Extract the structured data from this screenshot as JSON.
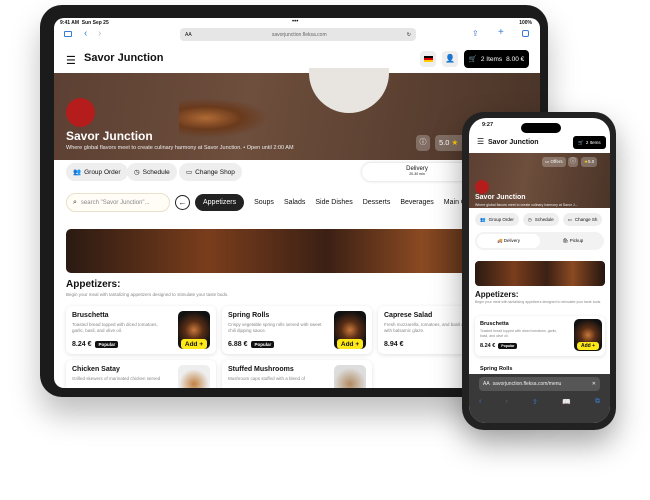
{
  "tablet": {
    "status": {
      "time": "9:41 AM",
      "date": "Sun Sep 25",
      "battery": "100%"
    },
    "browser": {
      "aa": "AA",
      "url": "savorjunction.fleksa.com"
    },
    "header": {
      "title": "Savor Junction",
      "cart_items": "2 Items",
      "cart_total": "8.00 €"
    },
    "hero": {
      "title": "Savor Junction",
      "subtitle": "Where global flavors meet to create culinary harmony at Savor Junction.",
      "open": "Open until 2:00 AM",
      "rating": "5.0"
    },
    "actions": [
      "Group Order",
      "Schedule",
      "Change Shop"
    ],
    "delivery": {
      "label": "Delivery",
      "time": "20-30 min"
    },
    "search_placeholder": "search \"Savor Junction\"...",
    "categories": [
      "Appetizers",
      "Soups",
      "Salads",
      "Side Dishes",
      "Desserts",
      "Beverages",
      "Main Cou"
    ],
    "section": {
      "title": "Appetizers:",
      "subtitle": "Begin your meal with tantalizing appetizers designed to stimulate your taste buds."
    },
    "add_label": "Add +",
    "popular": "Popular",
    "items": [
      {
        "name": "Bruschetta",
        "desc": "Toasted bread topped with diced tomatoes, garlic, basil, and olive oil.",
        "price": "8.24 €",
        "popular": true
      },
      {
        "name": "Spring Rolls",
        "desc": "Crispy vegetable spring rolls served with sweet chili dipping sauce.",
        "price": "6.88 €",
        "popular": true
      },
      {
        "name": "Caprese Salad",
        "desc": "Fresh mozzarella, tomatoes, and basil drizzled with balsamic glaze.",
        "price": "8.94 €",
        "popular": false
      },
      {
        "name": "Chicken Satay",
        "desc": "Grilled skewers of marinated chicken served",
        "price": "",
        "popular": false
      },
      {
        "name": "Stuffed Mushrooms",
        "desc": "Mushroom caps stuffed with a blend of",
        "price": "",
        "popular": false
      }
    ]
  },
  "phone": {
    "time": "9:27",
    "title": "Savor Junction",
    "cart": "2 Items",
    "offers": "Offers",
    "rating": "5.0",
    "hero_title": "Savor Junction",
    "hero_subtitle": "Where global flavors meet to create culinary harmony at Savor J...",
    "actions": [
      "Group Order",
      "Schedule",
      "Change Sh"
    ],
    "delivery": "Delivery",
    "pickup": "Pickup",
    "section_title": "Appetizers:",
    "section_subtitle": "Begin your meal with tantalizing appetizers designed to stimulate your taste buds.",
    "item": {
      "name": "Bruschetta",
      "desc": "Toasted bread topped with diced tomatoes, garlic, basil, and olive oil.",
      "price": "8.24 €"
    },
    "item2": "Spring Rolls",
    "popular": "Popular",
    "add": "Add +",
    "url_aa": "AA",
    "url": "savorjunction.fleksa.com/menu"
  },
  "colors": {
    "accent": "#ffe81a",
    "dark": "#111111",
    "safari_blue": "#3a7bd5"
  }
}
